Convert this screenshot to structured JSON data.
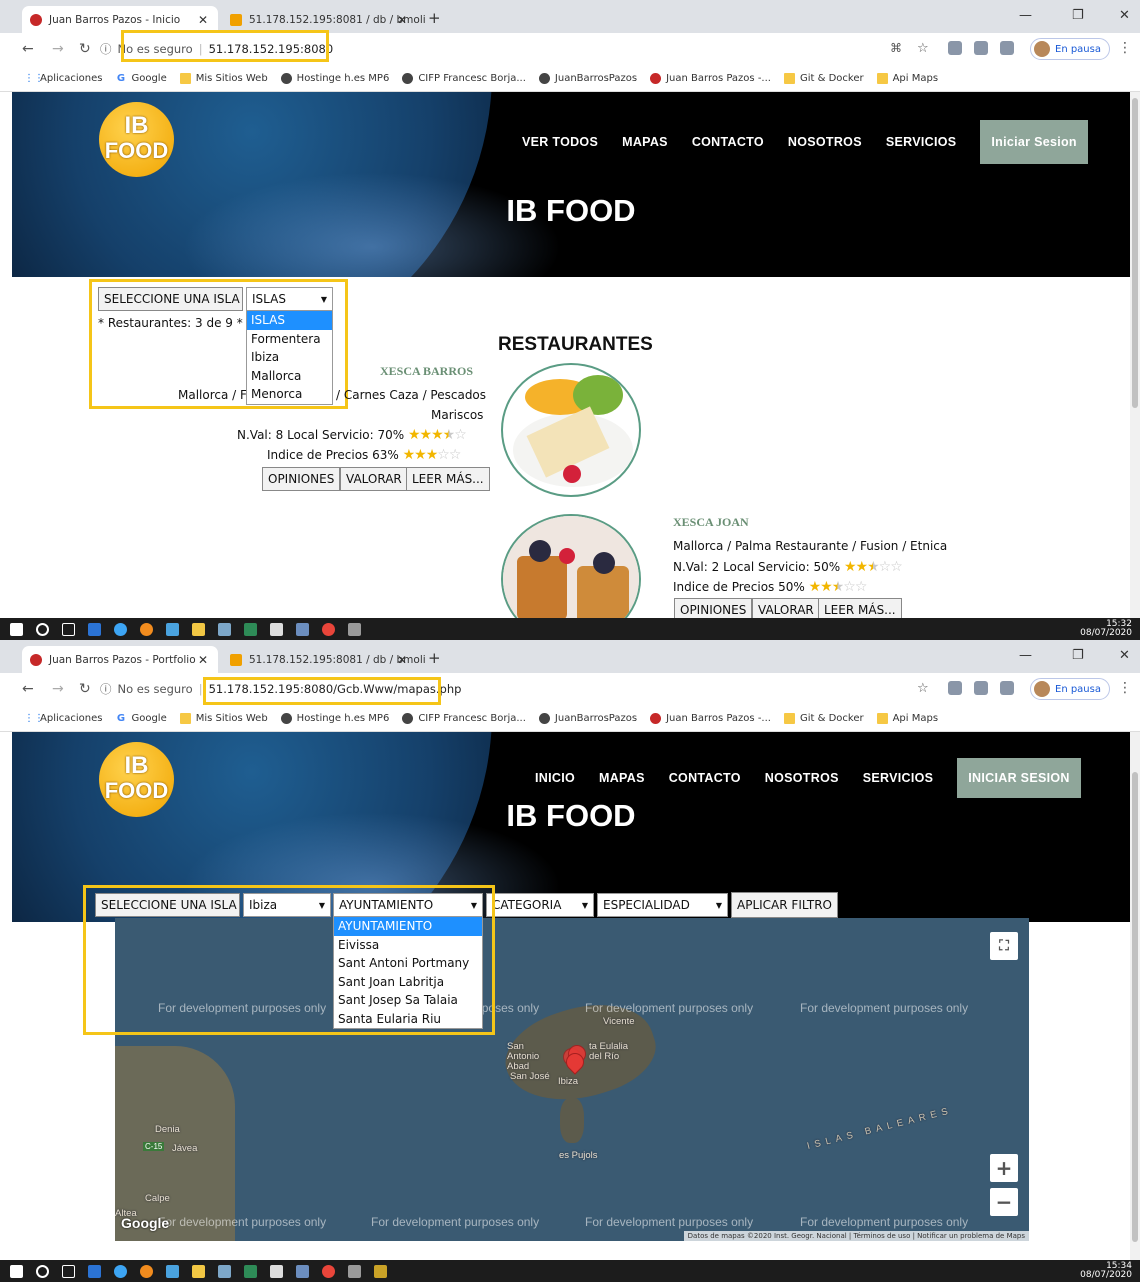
{
  "shot1": {
    "tabs": [
      {
        "title": "Juan Barros Pazos - Inicio",
        "color": "#c62828"
      },
      {
        "title": "51.178.152.195:8081 / db / bmoli",
        "color": "#f0a000"
      }
    ],
    "security": "No es seguro",
    "url": "51.178.152.195:8080",
    "nav": [
      "VER TODOS",
      "MAPAS",
      "CONTACTO",
      "NOSOTROS",
      "SERVICIOS"
    ],
    "signin": "Iniciar Sesion",
    "hero_title": "IB FOOD",
    "filter": {
      "label": "SELECCIONE UNA ISLA",
      "selected": "ISLAS",
      "options": [
        "ISLAS",
        "Formentera",
        "Ibiza",
        "Mallorca",
        "Menorca"
      ]
    },
    "count_text": "* Restaurantes: 3 de 9 * P",
    "restaurants_title": "RESTAURANTES",
    "r1": {
      "name": "XESCA BARROS",
      "line1a": "Mallorca / F",
      "line1b": "/ Carnes Caza / Pescados",
      "line2": "Mariscos",
      "val": "N.Val: 8 Local Servicio: 70%",
      "val_rating": 3.5,
      "price": "Indice de Precios 63%",
      "price_rating": 3
    },
    "r2": {
      "name": "XESCA JOAN",
      "line1": "Mallorca / Palma Restaurante / Fusion / Etnica",
      "val": "N.Val: 2 Local Servicio: 50%",
      "val_rating": 2.5,
      "price": "Indice de Precios 50%",
      "price_rating": 2.5
    },
    "buttons": [
      "OPINIONES",
      "VALORAR",
      "LEER MÁS..."
    ],
    "clock": {
      "time": "15:32",
      "date": "08/07/2020"
    }
  },
  "shot2": {
    "tabs": [
      {
        "title": "Juan Barros Pazos - Portfolio",
        "color": "#c62828"
      },
      {
        "title": "51.178.152.195:8081 / db / bmoli",
        "color": "#f0a000"
      }
    ],
    "security": "No es seguro",
    "url": "51.178.152.195:8080/Gcb.Www/mapas.php",
    "nav": [
      "INICIO",
      "MAPAS",
      "CONTACTO",
      "NOSOTROS",
      "SERVICIOS"
    ],
    "signin": "INICIAR SESION",
    "hero_title": "IB FOOD",
    "filter": {
      "label": "SELECCIONE UNA ISLA",
      "island": "Ibiza",
      "town": "AYUNTAMIENTO",
      "town_options": [
        "AYUNTAMIENTO",
        "Eivissa",
        "Sant Antoni Portmany",
        "Sant Joan Labritja",
        "Sant Josep Sa Talaia",
        "Santa Eularia Riu"
      ],
      "category": "CATEGORIA",
      "specialty": "ESPECIALIDAD",
      "apply": "APLICAR FILTRO"
    },
    "map": {
      "watermark": "For development purposes only",
      "places": [
        "Vicente",
        "San Antonio Abad",
        "ta Eulalia del Río",
        "San José",
        "Ibiza",
        "Denia",
        "Jávea",
        "Calpe",
        "Altea",
        "es Pujols",
        "ISLAS BALEARES"
      ],
      "road_badge": "C-15",
      "google": "Google",
      "attribution": "Datos de mapas ©2020 Inst. Geogr. Nacional | Términos de uso | Notificar un problema de Maps",
      "zoom_in": "+",
      "zoom_out": "−"
    },
    "clock": {
      "time": "15:34",
      "date": "08/07/2020"
    }
  },
  "bookmarks": [
    "Aplicaciones",
    "Google",
    "Mis Sitios Web",
    "Hostinge h.es MP6",
    "CIFP Francesc Borja...",
    "JuanBarrosPazos",
    "Juan Barros Pazos -...",
    "Git & Docker",
    "Api Maps"
  ],
  "pause_label": "En pausa",
  "highlight_color": "#f5c518"
}
